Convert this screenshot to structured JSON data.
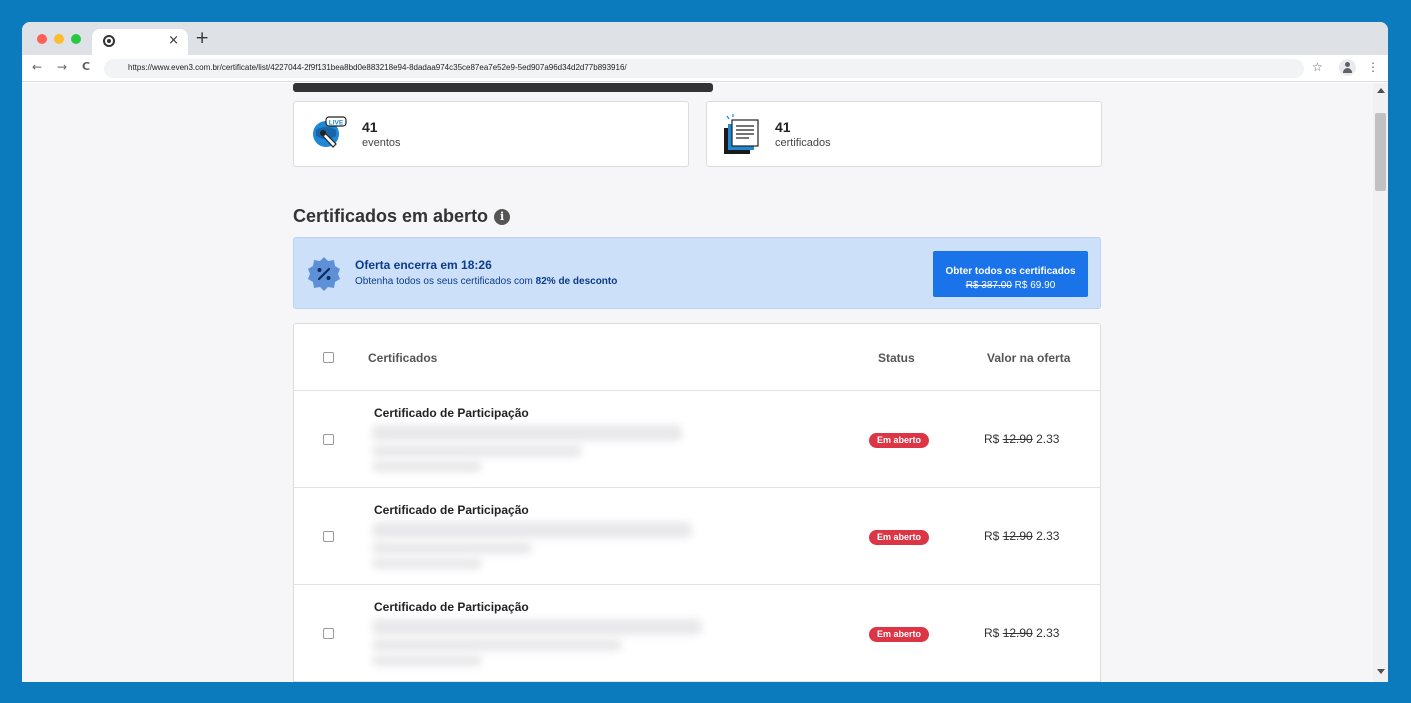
{
  "browser": {
    "tab_close": "×",
    "new_tab": "+",
    "back": "←",
    "forward": "→",
    "reload": "C",
    "url": "https://www.even3.com.br/certificate/list/4227044-2f9f131bea8bd0e883218e94-8dadaa974c35ce87ea7e52e9-5ed907a96d34d2d77b893916/",
    "star": "☆",
    "menu": "⋮"
  },
  "stats": {
    "events": {
      "count": "41",
      "label": "eventos"
    },
    "certificates": {
      "count": "41",
      "label": "certificados"
    }
  },
  "section": {
    "title": "Certificados em aberto",
    "info": "i"
  },
  "offer": {
    "title": "Oferta encerra em 18:26",
    "subtitle_prefix": "Obtenha todos os seus certificados com ",
    "subtitle_bold": "82% de desconto",
    "cta_label": "Obter todos os certificados",
    "cta_old_price": "R$ 387.00",
    "cta_new_price": "R$ 69.90"
  },
  "table": {
    "headers": {
      "certificates": "Certificados",
      "status": "Status",
      "value": "Valor na oferta"
    },
    "rows": [
      {
        "title": "Certificado de Participação",
        "status": "Em aberto",
        "currency": "R$",
        "old_price": "12.90",
        "new_price": "2.33"
      },
      {
        "title": "Certificado de Participação",
        "status": "Em aberto",
        "currency": "R$",
        "old_price": "12.90",
        "new_price": "2.33"
      },
      {
        "title": "Certificado de Participação",
        "status": "Em aberto",
        "currency": "R$",
        "old_price": "12.90",
        "new_price": "2.33"
      }
    ]
  },
  "colors": {
    "page_frame": "#0b7bbd",
    "offer_bg": "#cce0fa",
    "offer_text": "#0d3b8c",
    "cta_bg": "#1a73e8",
    "status_badge": "#dc3545"
  },
  "icons": {
    "events": "live-globe-icon",
    "certificates": "document-stack-icon",
    "offer": "discount-badge-icon",
    "info": "info-icon"
  }
}
